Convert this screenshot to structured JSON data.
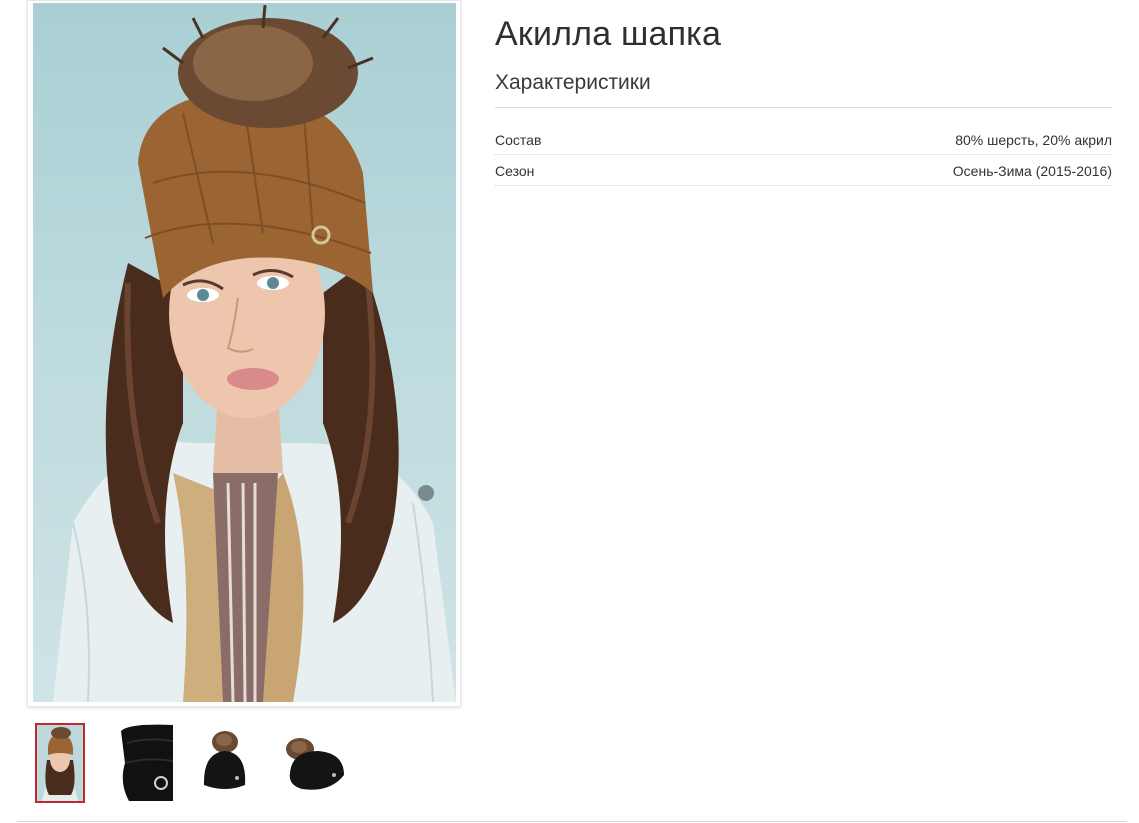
{
  "product": {
    "title": "Акилла шапка",
    "main_image": "woman-in-brown-knit-hat-with-fur-pompom"
  },
  "specs": {
    "heading": "Характеристики",
    "rows": [
      {
        "label": "Состав",
        "value": "80% шерсть, 20% акрил"
      },
      {
        "label": "Сезон",
        "value": "Осень-Зима (2015-2016)"
      }
    ]
  },
  "gallery": {
    "thumbnails": [
      {
        "image": "woman-brown-hat-thumbnail",
        "active": true
      },
      {
        "image": "black-hat-side-thumbnail",
        "active": false
      },
      {
        "image": "black-hat-pompom-front-thumbnail",
        "active": false
      },
      {
        "image": "black-hat-pompom-side-thumbnail",
        "active": false
      }
    ]
  },
  "colors": {
    "active_thumb_border": "#c0282d",
    "hat_brown": "#9a6433",
    "background_teal": "#b9d8db"
  }
}
